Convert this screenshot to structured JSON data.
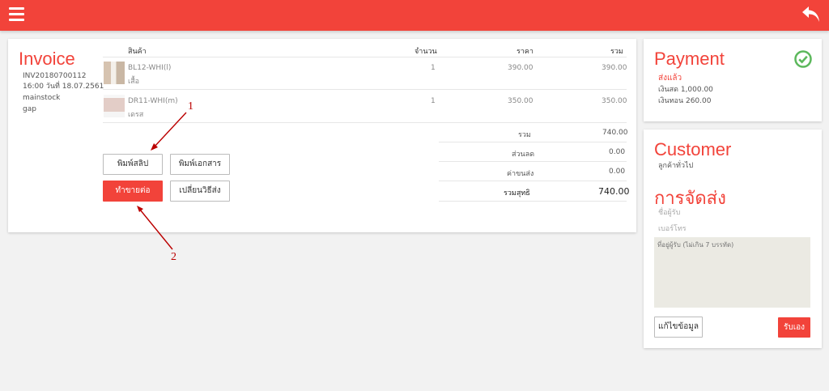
{
  "header": {
    "menu_icon": "menu-icon",
    "back_icon": "back-arrow-icon",
    "bar_color": "#f2433a"
  },
  "invoice": {
    "title": "Invoice",
    "number": "INV20180700112",
    "datetime": "16:00 วันที่ 18.07.2561",
    "stock": "mainstock",
    "staff": "gap",
    "columns": {
      "product": "สินค้า",
      "qty": "จำนวน",
      "price": "ราคา",
      "total": "รวม"
    },
    "items": [
      {
        "sku": "BL12-WHI(l)",
        "name": "เสื้อ",
        "qty": "1",
        "price": "390.00",
        "total": "390.00"
      },
      {
        "sku": "DR11-WHI(m)",
        "name": "เดรส",
        "qty": "1",
        "price": "350.00",
        "total": "350.00"
      }
    ],
    "summary": [
      {
        "label": "รวม",
        "value": "740.00"
      },
      {
        "label": "ส่วนลด",
        "value": "0.00"
      },
      {
        "label": "ค่าขนส่ง",
        "value": "0.00"
      },
      {
        "label": "รวมสุทธิ",
        "value": "740.00"
      }
    ],
    "buttons": {
      "print_slip": "พิมพ์สลิป",
      "print_doc": "พิมพ์เอกสาร",
      "continue_sale": "ทำขายต่อ",
      "change_shipping": "เปลี่ยนวิธีส่ง"
    },
    "annotations": {
      "one": "1",
      "two": "2"
    }
  },
  "payment": {
    "title": "Payment",
    "status": "ส่งแล้ว",
    "cash": "เงินสด 1,000.00",
    "change": "เงินทอน 260.00",
    "status_icon": "check-circle-icon"
  },
  "customer": {
    "title": "Customer",
    "type": "ลูกค้าทั่วไป",
    "shipping_title": "การจัดส่ง",
    "receiver_placeholder": "ชื่อผู้รับ",
    "phone_placeholder": "เบอร์โทร",
    "address_placeholder": "ที่อยู่ผู้รับ (ไม่เกิน 7 บรรทัด)",
    "edit_button": "แก้ไขข้อมูล",
    "pickup_button": "รับเอง"
  }
}
